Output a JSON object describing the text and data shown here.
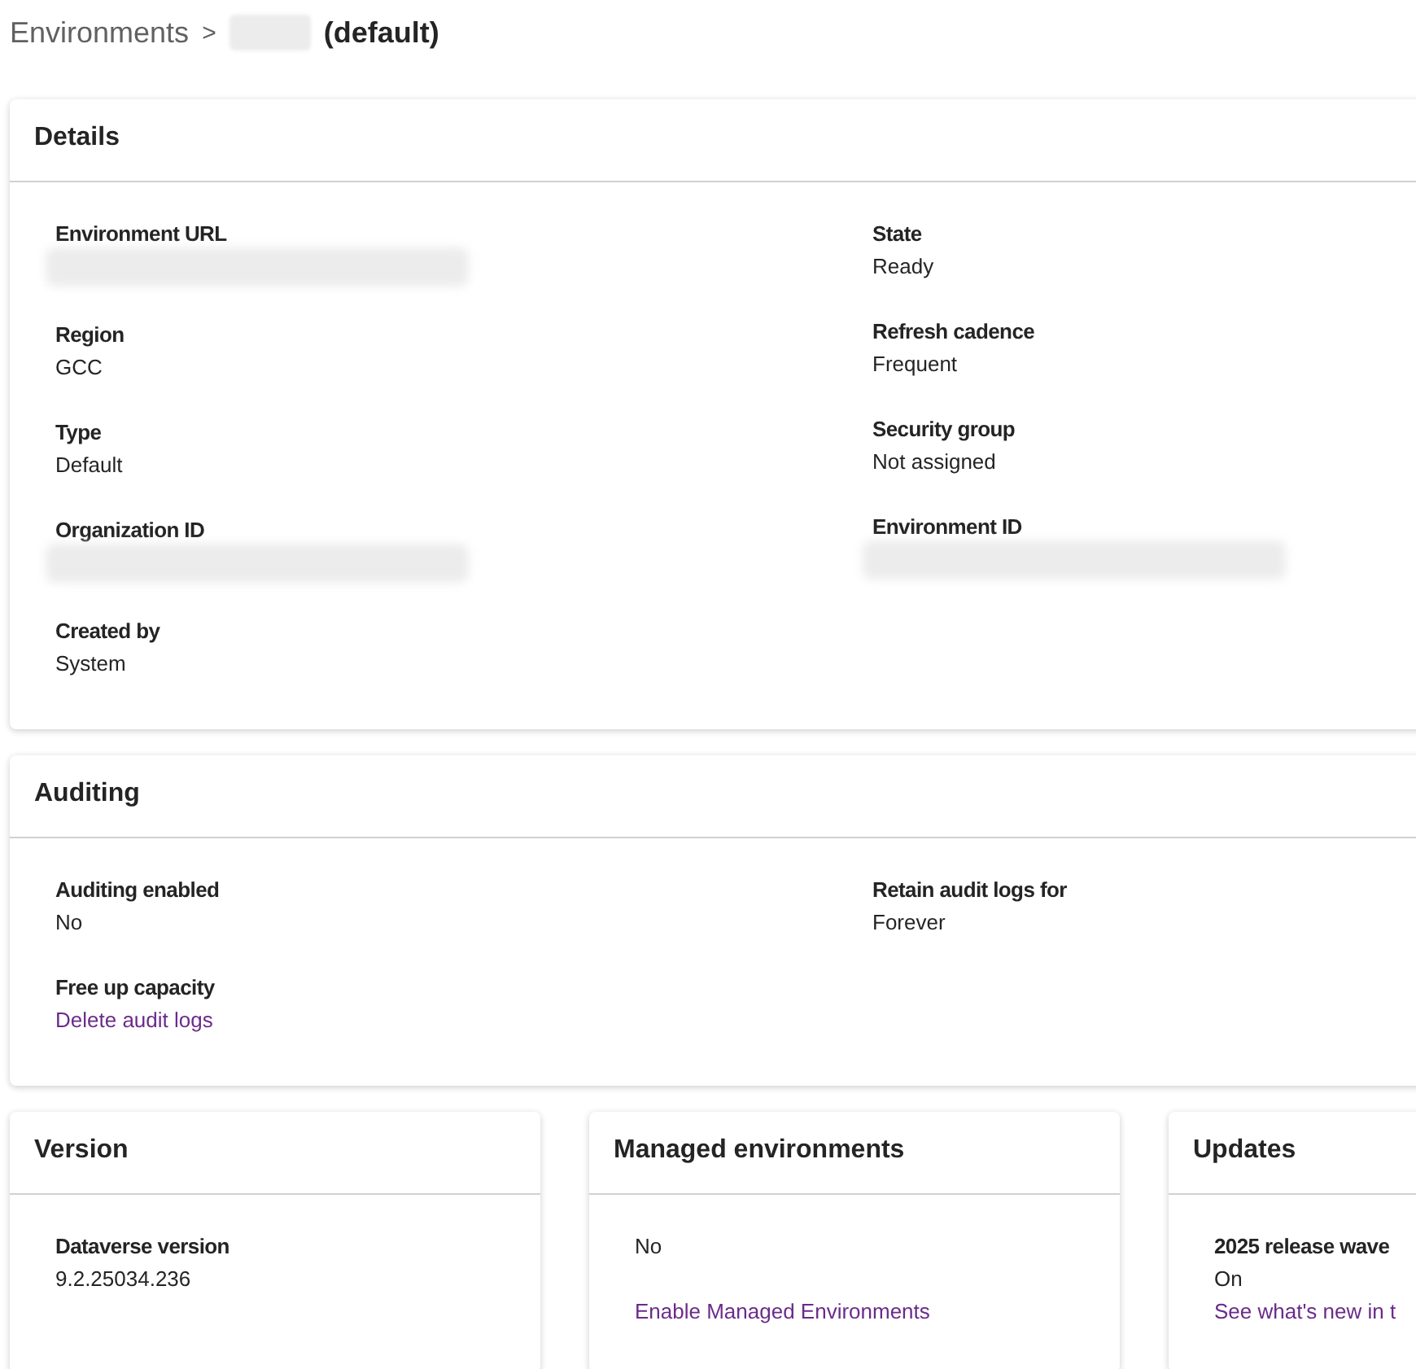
{
  "breadcrumb": {
    "parent": "Environments",
    "separator": ">",
    "current": "(default)"
  },
  "details": {
    "title": "Details",
    "columns": [
      [
        {
          "label": "Environment URL",
          "kind": "redacted"
        },
        {
          "label": "Region",
          "kind": "text",
          "value": "GCC"
        },
        {
          "label": "Type",
          "kind": "text",
          "value": "Default"
        },
        {
          "label": "Organization ID",
          "kind": "redacted"
        },
        {
          "label": "Created by",
          "kind": "text",
          "value": "System"
        }
      ],
      [
        {
          "label": "State",
          "kind": "text",
          "value": "Ready"
        },
        {
          "label": "Refresh cadence",
          "kind": "text",
          "value": "Frequent"
        },
        {
          "label": "Security group",
          "kind": "text",
          "value": "Not assigned"
        },
        {
          "label": "Environment ID",
          "kind": "redacted"
        }
      ]
    ]
  },
  "auditing": {
    "title": "Auditing",
    "columns": [
      [
        {
          "label": "Auditing enabled",
          "kind": "text",
          "value": "No"
        },
        {
          "label": "Free up capacity",
          "kind": "link",
          "value": "Delete audit logs"
        }
      ],
      [
        {
          "label": "Retain audit logs for",
          "kind": "text",
          "value": "Forever"
        }
      ]
    ]
  },
  "version": {
    "title": "Version",
    "fields": [
      {
        "label": "Dataverse version",
        "kind": "text",
        "value": "9.2.25034.236"
      }
    ]
  },
  "managed_environments": {
    "title": "Managed environments",
    "value": "No",
    "link": "Enable Managed Environments"
  },
  "updates": {
    "title": "Updates",
    "fields": [
      {
        "label": "2025 release wave",
        "kind": "text",
        "value": "On"
      }
    ],
    "link": "See what's new in t"
  }
}
